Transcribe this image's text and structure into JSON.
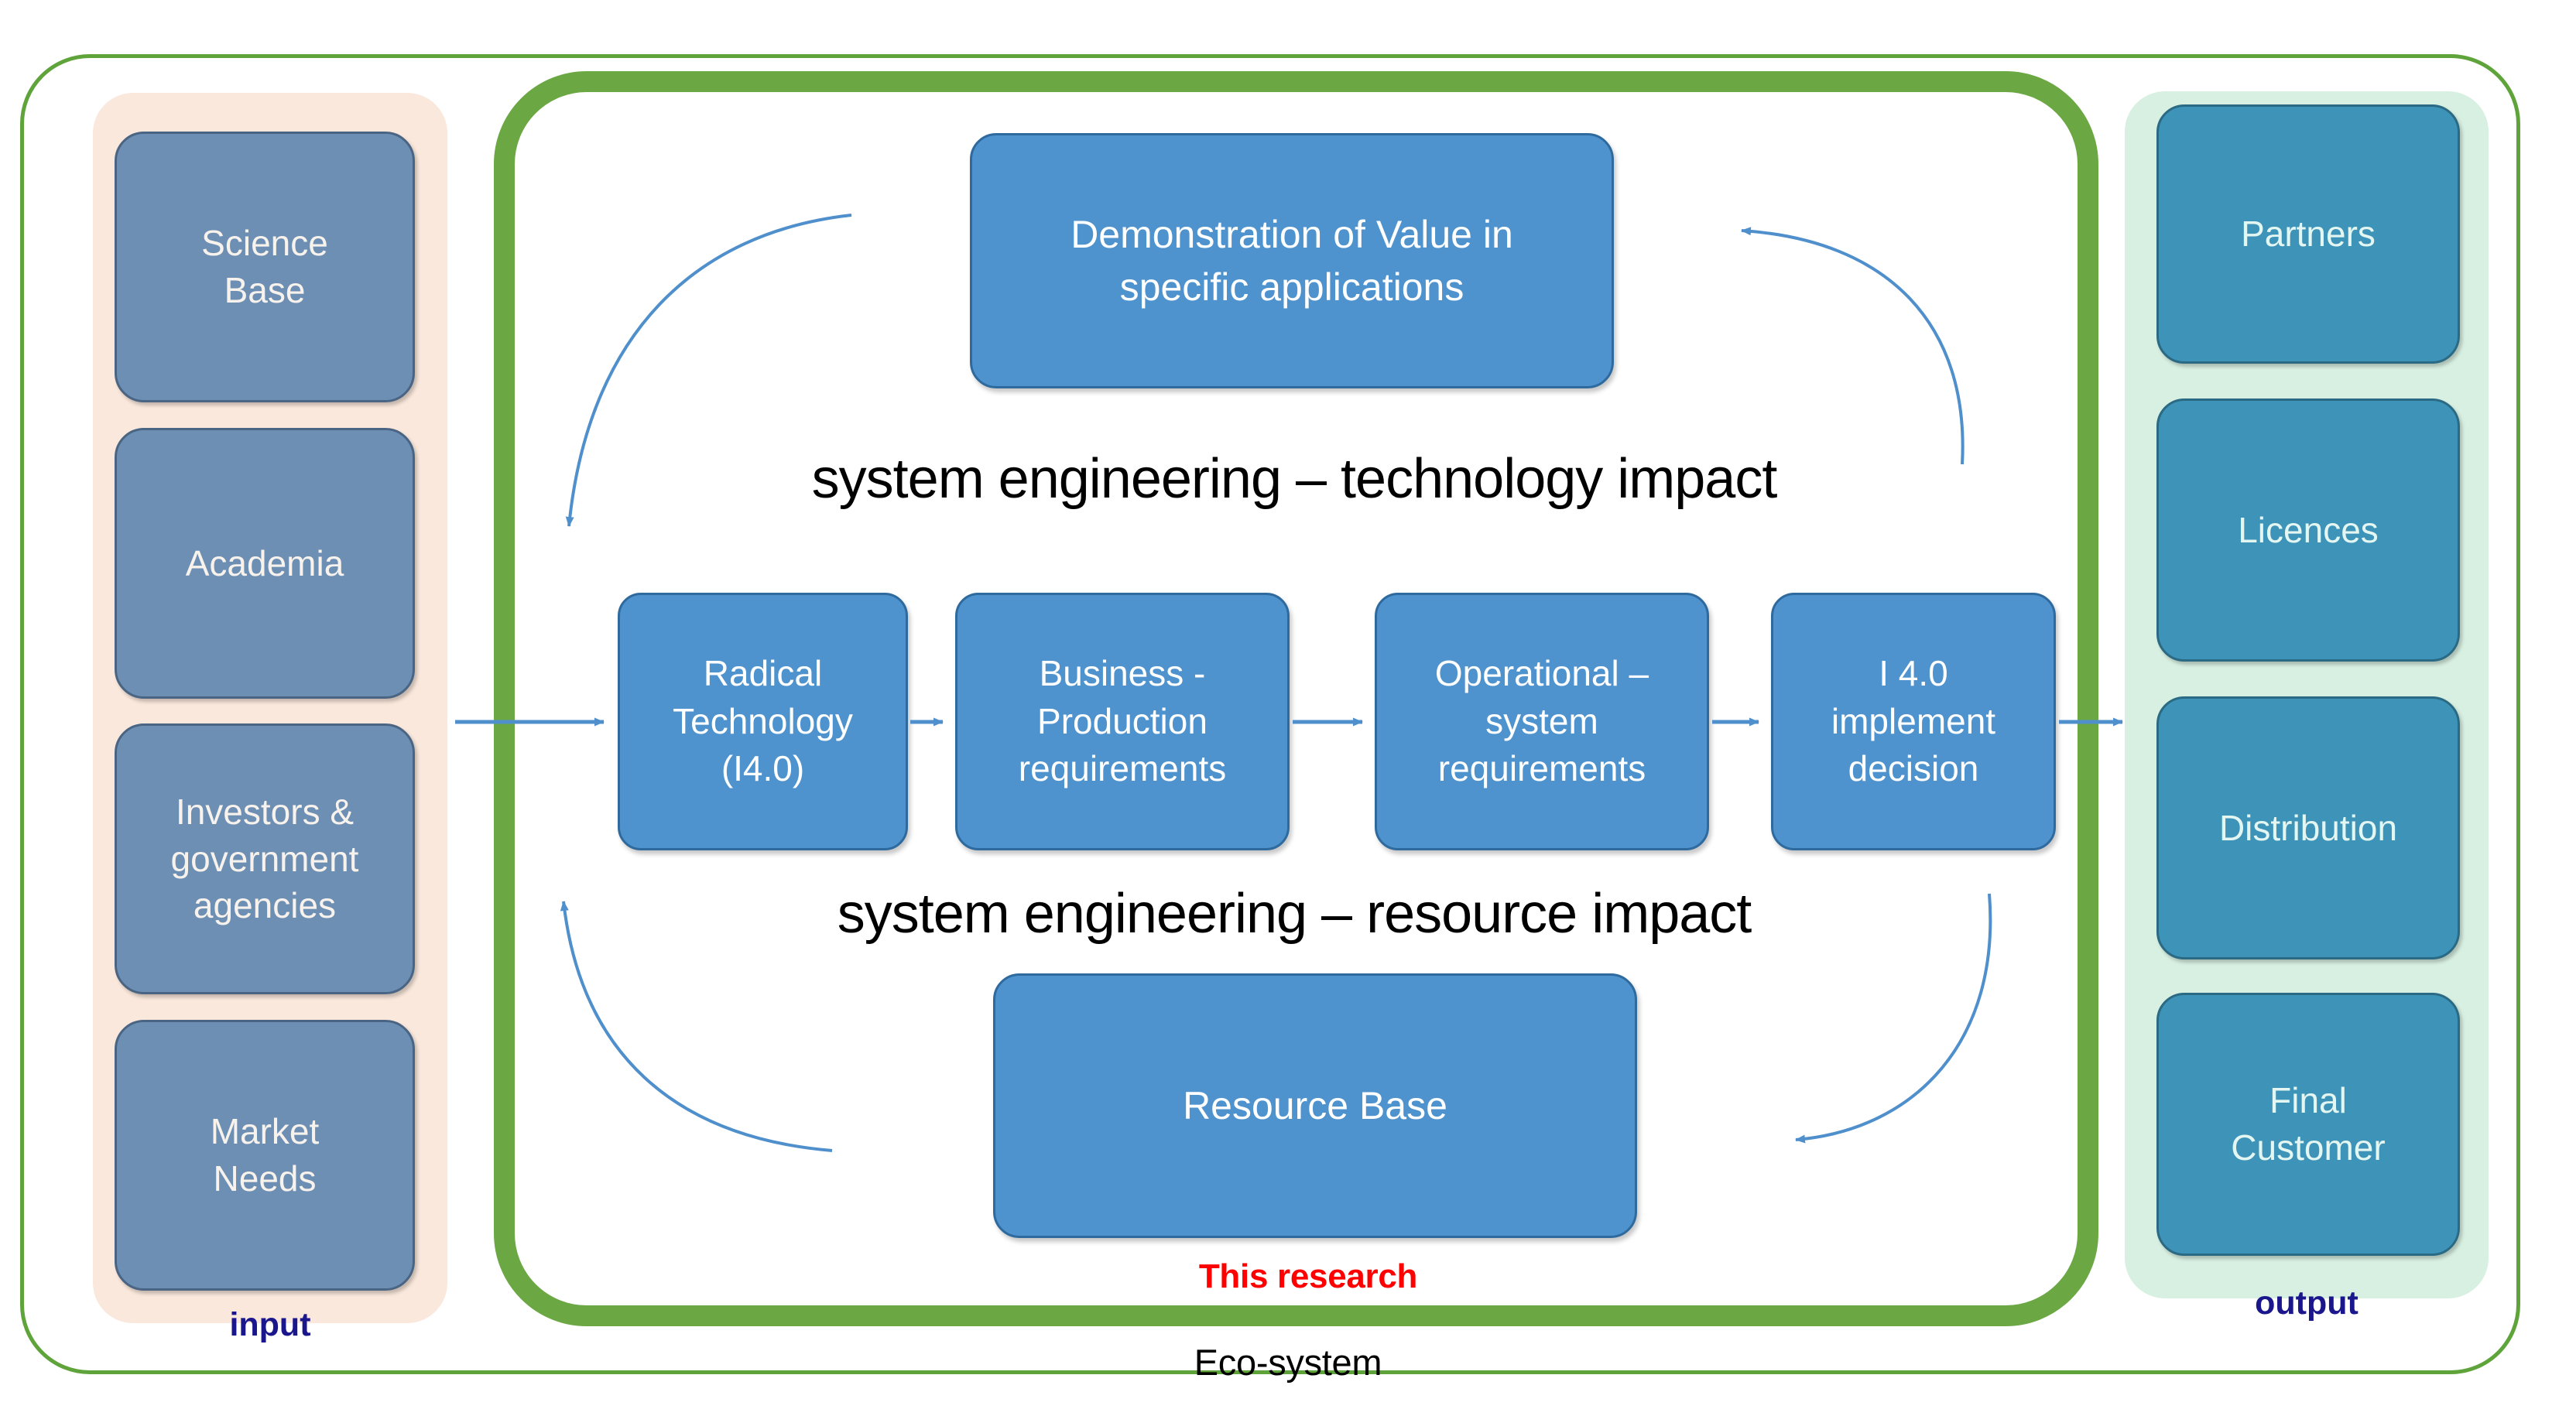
{
  "diagram": {
    "ecosystem_label": "Eco-system",
    "research_label": "This research",
    "captions": {
      "technology_impact": "system engineering – technology impact",
      "resource_impact": "system engineering – resource impact"
    },
    "value_box": "Demonstration of Value in specific applications",
    "value_box_line1": "Demonstration of Value in",
    "value_box_line2": "specific applications",
    "resource_box": "Resource Base"
  },
  "input": {
    "label": "input",
    "panel_color": "#FAE8DC",
    "box_color": "#6E8FB4",
    "items": [
      {
        "line1": "Science",
        "line2": "Base"
      },
      {
        "line1": "Academia",
        "line2": ""
      },
      {
        "line1": "Investors &",
        "line2": "government",
        "line3": "agencies"
      },
      {
        "line1": "Market",
        "line2": "Needs"
      }
    ]
  },
  "output": {
    "label": "output",
    "panel_color": "#D8F0E2",
    "box_color": "#3E94B8",
    "items": [
      {
        "line1": "Partners",
        "line2": ""
      },
      {
        "line1": "Licences",
        "line2": ""
      },
      {
        "line1": "Distribution",
        "line2": ""
      },
      {
        "line1": "Final",
        "line2": "Customer"
      }
    ]
  },
  "process": {
    "box_color": "#4E92CE",
    "steps": [
      {
        "line1": "Radical",
        "line2": "Technology",
        "line3": "(I4.0)"
      },
      {
        "line1": "Business -",
        "line2": "Production",
        "line3": "requirements"
      },
      {
        "line1": "Operational –",
        "line2": "system",
        "line3": "requirements"
      },
      {
        "line1": "I 4.0",
        "line2": "implement",
        "line3": "decision"
      }
    ]
  },
  "colors": {
    "ecosystem_border": "#5FA43B",
    "research_border": "#6BA844",
    "research_text": "#FF0000",
    "io_label_text": "#1A168C",
    "arrow_blue": "#4E8FCC"
  }
}
